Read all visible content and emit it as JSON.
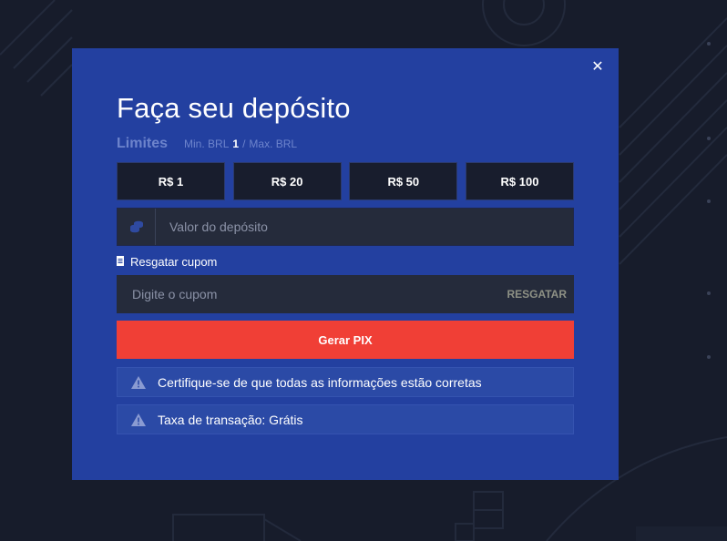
{
  "modal": {
    "title": "Faça seu depósito",
    "limits": {
      "label": "Limites",
      "min_label": "Min. BRL",
      "min_value": "1",
      "separator": "/",
      "max_label": "Max. BRL"
    },
    "amount_options": [
      "R$ 1",
      "R$ 20",
      "R$ 50",
      "R$ 100"
    ],
    "deposit_field": {
      "placeholder": "Valor do depósito",
      "icon": "coins-icon"
    },
    "coupon_link": {
      "label": "Resgatar cupom",
      "icon": "document-icon"
    },
    "coupon_field": {
      "placeholder": "Digite o cupom",
      "button_label": "RESGATAR"
    },
    "generate_button": "Gerar PIX",
    "notices": [
      {
        "icon": "warning-icon",
        "text": "Certifique-se de que todas as informações estão corretas"
      },
      {
        "icon": "warning-icon",
        "text": "Taxa de transação: Grátis"
      }
    ],
    "close_icon": "close-icon"
  },
  "colors": {
    "page_background": "#171c2b",
    "modal_background": "#2340a0",
    "primary_button": "#f03f36",
    "input_background": "#252b3b",
    "amount_button_background": "#181d2d",
    "muted_text": "#6d84cc"
  }
}
